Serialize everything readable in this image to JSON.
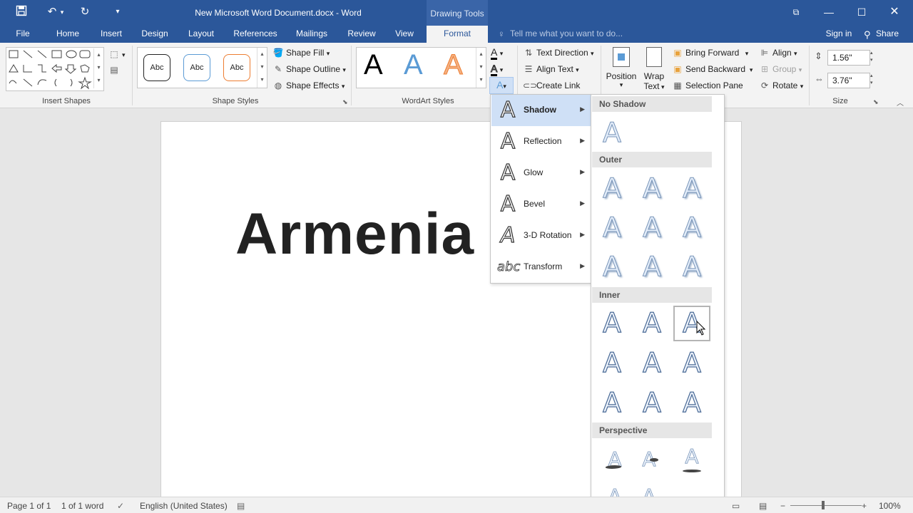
{
  "titlebar": {
    "doc_title": "New Microsoft Word Document.docx - Word",
    "contextual": "Drawing Tools",
    "qat": [
      "save-icon",
      "undo-icon",
      "redo-icon",
      "customize-icon"
    ]
  },
  "tabs": [
    "File",
    "Home",
    "Insert",
    "Design",
    "Layout",
    "References",
    "Mailings",
    "Review",
    "View",
    "Format"
  ],
  "tell_me": "Tell me what you want to do...",
  "account": {
    "sign_in": "Sign in",
    "share": "Share"
  },
  "ribbon": {
    "insert_shapes": "Insert Shapes",
    "shape_styles": {
      "label": "Shape Styles",
      "samples": [
        "Abc",
        "Abc",
        "Abc"
      ],
      "fill": "Shape Fill",
      "outline": "Shape Outline",
      "effects": "Shape Effects"
    },
    "wordart": {
      "label": "WordArt Styles",
      "samples": [
        "A",
        "A",
        "A"
      ]
    },
    "text": {
      "direction": "Text Direction",
      "align": "Align Text",
      "link": "Create Link"
    },
    "arrange": {
      "position": "Position",
      "wrap1": "Wrap",
      "wrap2": "Text",
      "forward": "Bring Forward",
      "backward": "Send Backward",
      "pane": "Selection Pane",
      "align": "Align",
      "group": "Group",
      "rotate": "Rotate"
    },
    "size": {
      "label": "Size",
      "height": "1.56\"",
      "width": "3.76\""
    }
  },
  "document": {
    "wordart_text": "Armenia"
  },
  "effects_menu": [
    {
      "label": "Shadow",
      "selected": true
    },
    {
      "label": "Reflection"
    },
    {
      "label": "Glow"
    },
    {
      "label": "Bevel"
    },
    {
      "label": "3-D Rotation"
    },
    {
      "label": "Transform"
    }
  ],
  "shadow_submenu": {
    "no_shadow": "No Shadow",
    "outer": "Outer",
    "inner": "Inner",
    "perspective": "Perspective"
  },
  "status": {
    "page": "Page 1 of 1",
    "words": "1 of 1 word",
    "language": "English (United States)",
    "zoom": "100%"
  }
}
